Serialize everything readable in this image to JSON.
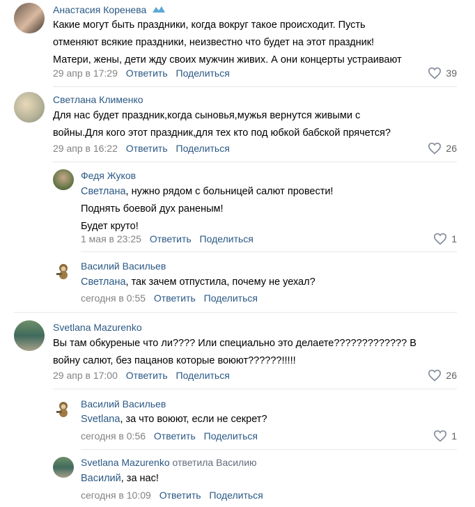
{
  "comments": [
    {
      "author": "Анастасия Коренева",
      "text_lines": [
        "Какие могут быть праздники, когда вокруг такое происходит. Пусть",
        "отменяют всякие праздники, неизвестно что будет на этот праздник!",
        "Матери, жены, дети жду своих мужчин живих. А они концерты устраивают"
      ],
      "date": "29 апр в 17:29",
      "reply": "Ответить",
      "share": "Поделиться",
      "likes": "39"
    },
    {
      "author": "Светлана Клименко",
      "text_lines": [
        "Для нас будет праздник,когда сыновья,мужья вернутся живыми с",
        "войны.Для кого этот праздник,для тех кто под юбкой бабской прячется?"
      ],
      "date": "29 апр в 16:22",
      "reply": "Ответить",
      "share": "Поделиться",
      "likes": "26"
    },
    {
      "author": "Федя Жуков",
      "mention": "Светлана",
      "text_lines": [
        ", нужно рядом с больницей салют провести!",
        "Поднять боевой дух раненым!",
        "Будет круто!"
      ],
      "date": "1 мая в 23:25",
      "reply": "Ответить",
      "share": "Поделиться",
      "likes": "1"
    },
    {
      "author": "Василий Васильев",
      "mention": "Светлана",
      "text_lines": [
        ", так зачем отпустила, почему не уехал?"
      ],
      "date": "сегодня в 0:55",
      "reply": "Ответить",
      "share": "Поделиться"
    },
    {
      "author": "Svetlana Mazurenko",
      "text_lines": [
        "Вы там обкуреные что ли???? Или специально это делаете????????????? В",
        "войну салют, без пацанов которые воюют??????!!!!!"
      ],
      "date": "29 апр в 17:00",
      "reply": "Ответить",
      "share": "Поделиться",
      "likes": "26"
    },
    {
      "author": "Василий Васильев",
      "mention": "Svetlana",
      "text_lines": [
        ", за что воюют, если не секрет?"
      ],
      "date": "сегодня в 0:56",
      "reply": "Ответить",
      "share": "Поделиться",
      "likes": "1"
    },
    {
      "author": "Svetlana Mazurenko",
      "reply_to": "ответила Василию",
      "mention": "Василий",
      "text_lines": [
        ", за нас!"
      ],
      "date": "сегодня в 10:09",
      "reply": "Ответить",
      "share": "Поделиться"
    }
  ],
  "colors": {
    "link": "#2a5885",
    "meta": "#828282",
    "divider": "#e4e7ea"
  },
  "icons": {
    "like": "heart-outline-icon",
    "verified": "verified-badge-icon"
  }
}
